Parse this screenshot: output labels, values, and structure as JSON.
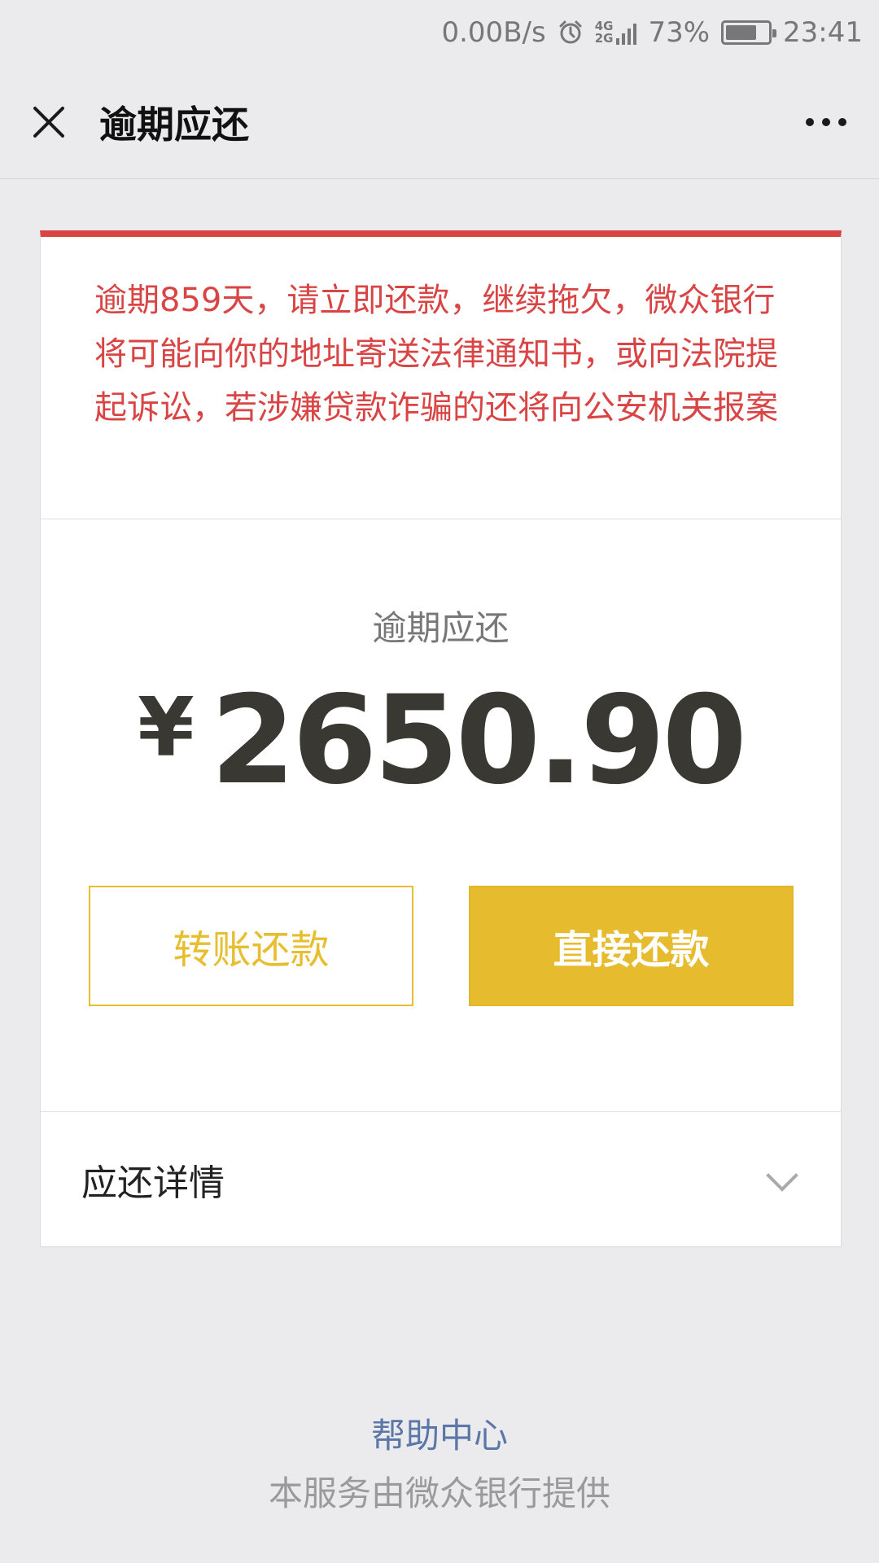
{
  "status_bar": {
    "network_speed": "0.00B/s",
    "alarm_icon": "alarm-clock-icon",
    "network_top": "4G",
    "network_bottom": "2G",
    "battery_percent": "73%",
    "battery_level": 0.73,
    "time": "23:41"
  },
  "nav": {
    "title": "逾期应还",
    "close_icon": "close-icon",
    "more_icon": "more-dots-icon"
  },
  "warning": {
    "text": "逾期859天，请立即还款，继续拖欠，微众银行将可能向你的地址寄送法律通知书，或向法院提起诉讼，若涉嫌贷款诈骗的还将向公安机关报案"
  },
  "amount": {
    "label": "逾期应还",
    "currency": "¥",
    "value": "2650.90"
  },
  "buttons": {
    "transfer_label": "转账还款",
    "direct_label": "直接还款"
  },
  "details": {
    "label": "应还详情"
  },
  "footer": {
    "help_center": "帮助中心",
    "provider": "本服务由微众银行提供"
  },
  "colors": {
    "accent_red": "#d94545",
    "accent_yellow": "#e6bb2d",
    "link_blue": "#5b77a8"
  }
}
